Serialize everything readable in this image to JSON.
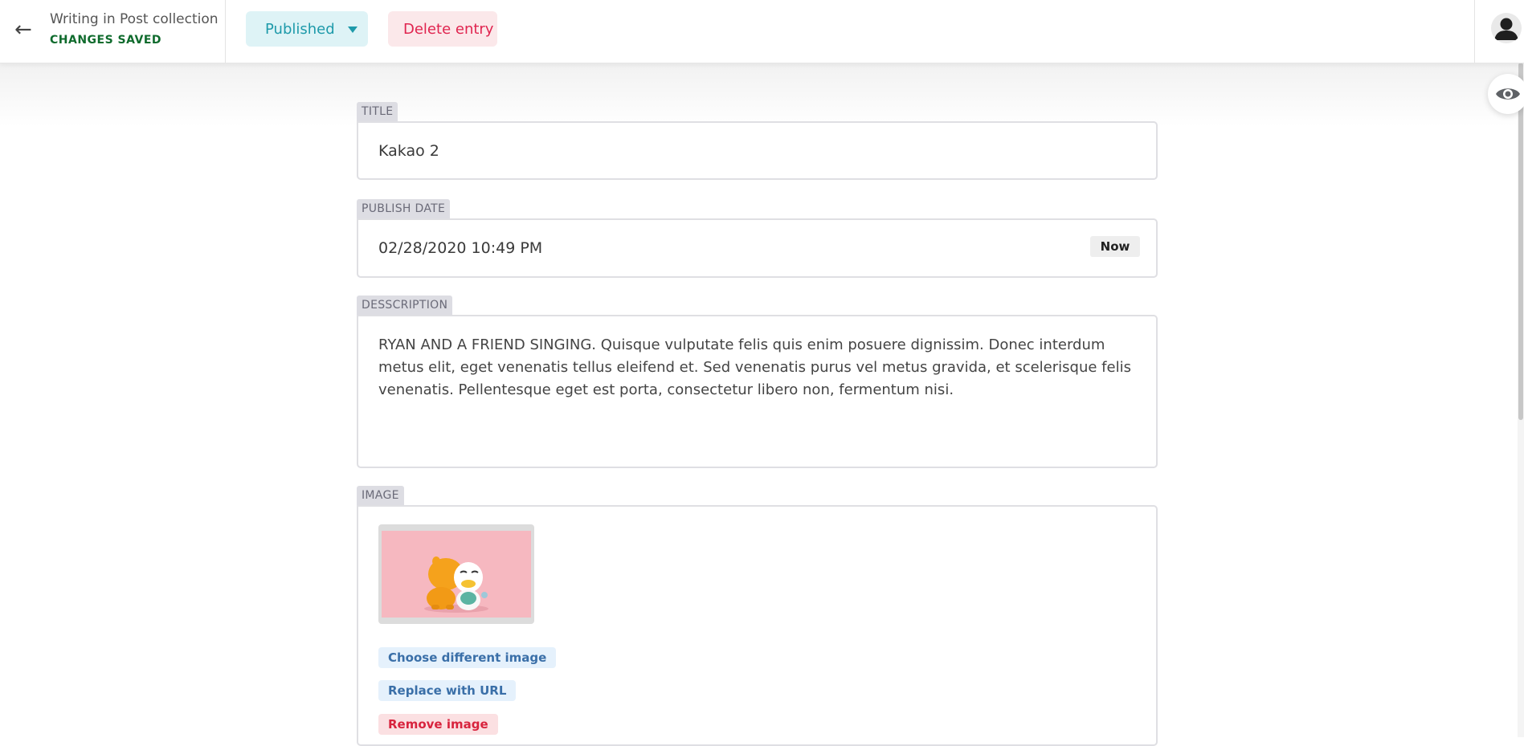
{
  "header": {
    "back_icon": "arrow-left-icon",
    "collection_title": "Writing in Post collection",
    "save_status": "CHANGES SAVED",
    "status_label": "Published",
    "delete_label": "Delete entry",
    "colors": {
      "status_bg": "#def3f6",
      "status_text": "#1e9aaa",
      "delete_bg": "#fbe8ea",
      "delete_text": "#e0244f",
      "saved_text": "#0f6b2d"
    }
  },
  "fields": {
    "title": {
      "label": "TITLE",
      "value": "Kakao 2"
    },
    "publish_date": {
      "label": "PUBLISH DATE",
      "value": "02/28/2020 10:49 PM",
      "now_label": "Now"
    },
    "description": {
      "label": "DESSCRIPTION",
      "value": "RYAN AND A FRIEND SINGING. Quisque vulputate felis quis enim posuere dignissim. Donec interdum metus elit, eget venenatis tellus eleifend et. Sed venenatis purus vel metus gravida, et scelerisque felis venenatis. Pellentesque eget est porta, consectetur libero non, fermentum nisi."
    },
    "image": {
      "label": "IMAGE",
      "choose_label": "Choose different image",
      "replace_label": "Replace with URL",
      "remove_label": "Remove image"
    }
  },
  "icons": {
    "preview": "eye-icon",
    "avatar": "user-avatar-icon"
  }
}
